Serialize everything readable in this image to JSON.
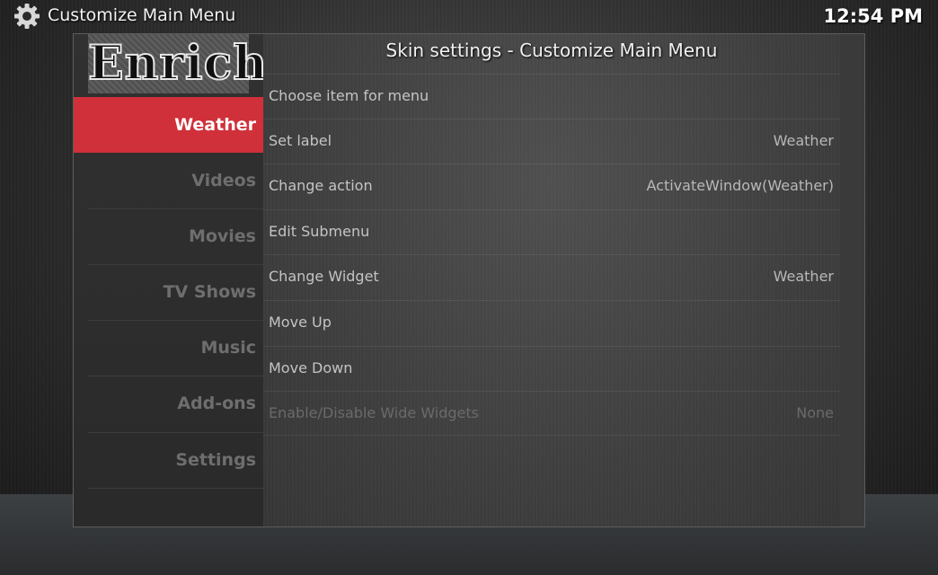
{
  "header": {
    "title": "Customize Main Menu",
    "clock": "12:54 PM",
    "icon": "gear-icon"
  },
  "logo": {
    "text": "Enrich"
  },
  "dialog": {
    "title": "Skin settings - Customize Main Menu"
  },
  "sidebar": {
    "items": [
      {
        "label": "Weather",
        "active": true
      },
      {
        "label": "Videos"
      },
      {
        "label": "Movies"
      },
      {
        "label": "TV Shows"
      },
      {
        "label": "Music"
      },
      {
        "label": "Add-ons"
      },
      {
        "label": "Settings"
      }
    ]
  },
  "options": [
    {
      "label": "Choose item for menu",
      "value": ""
    },
    {
      "label": "Set label",
      "value": "Weather"
    },
    {
      "label": "Change action",
      "value": "ActivateWindow(Weather)"
    },
    {
      "label": "Edit Submenu",
      "value": ""
    },
    {
      "label": "Change Widget",
      "value": "Weather"
    },
    {
      "label": "Move Up",
      "value": ""
    },
    {
      "label": "Move Down",
      "value": ""
    },
    {
      "label": "Enable/Disable Wide Widgets",
      "value": "None",
      "disabled": true
    }
  ],
  "colors": {
    "accent": "#d0303a",
    "background": "#2c2c2c"
  }
}
